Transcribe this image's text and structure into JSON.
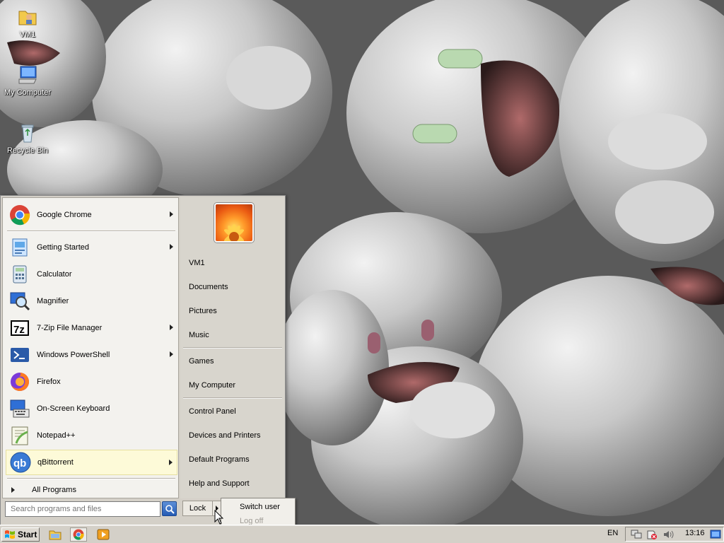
{
  "desktop": {
    "icons": [
      {
        "label": "VM1",
        "icon": "user-folder-icon"
      },
      {
        "label": "My Computer",
        "icon": "computer-icon"
      },
      {
        "label": "Recycle Bin",
        "icon": "recycle-bin-icon"
      }
    ]
  },
  "start_menu": {
    "pinned": [
      {
        "label": "Google Chrome",
        "icon": "chrome-icon",
        "has_submenu": true
      }
    ],
    "recent": [
      {
        "label": "Getting Started",
        "icon": "getting-started-icon",
        "has_submenu": true
      },
      {
        "label": "Calculator",
        "icon": "calculator-icon",
        "has_submenu": false
      },
      {
        "label": "Magnifier",
        "icon": "magnifier-icon",
        "has_submenu": false
      },
      {
        "label": "7-Zip File Manager",
        "icon": "seven-zip-icon",
        "has_submenu": true
      },
      {
        "label": "Windows PowerShell",
        "icon": "powershell-icon",
        "has_submenu": true
      },
      {
        "label": "Firefox",
        "icon": "firefox-icon",
        "has_submenu": false
      },
      {
        "label": "On-Screen Keyboard",
        "icon": "keyboard-icon",
        "has_submenu": false
      },
      {
        "label": "Notepad++",
        "icon": "notepad-plus-plus-icon",
        "has_submenu": false
      },
      {
        "label": "qBittorrent",
        "icon": "qbittorrent-icon",
        "has_submenu": true,
        "highlighted": true
      }
    ],
    "all_programs": "All Programs",
    "right_pane": {
      "user": "VM1",
      "group1": [
        "Documents",
        "Pictures",
        "Music"
      ],
      "group2": [
        "Games",
        "My Computer"
      ],
      "group3": [
        "Control Panel",
        "Devices and Printers",
        "Default Programs",
        "Help and Support"
      ]
    },
    "search_placeholder": "Search programs and files",
    "lock_label": "Lock",
    "lock_submenu": [
      {
        "label": "Switch user",
        "enabled": true
      },
      {
        "label": "Log off",
        "enabled": false
      }
    ]
  },
  "taskbar": {
    "start_label": "Start",
    "quick_launch": [
      "file-explorer-icon",
      "chrome-icon",
      "media-player-icon"
    ],
    "language": "EN",
    "tray_icons": [
      "network-icon",
      "action-center-icon",
      "volume-icon"
    ],
    "clock": "13:16"
  },
  "colors": {
    "menu_bg": "#d4d0c8",
    "left_pane_bg": "#f3f2ee",
    "highlight_bg": "#fdfad8",
    "search_button": "#245bb4"
  }
}
